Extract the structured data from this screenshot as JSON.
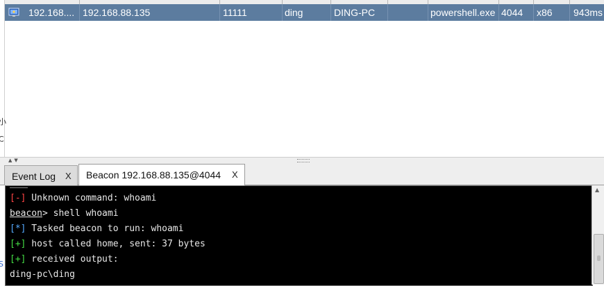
{
  "sessions": {
    "rows": [
      {
        "external": "192.168....",
        "internal": "192.168.88.135",
        "listener": "11111",
        "user": "ding",
        "computer": "DING-PC",
        "process": "powershell.exe",
        "pid": "4044",
        "arch": "x86",
        "last": "943ms"
      }
    ]
  },
  "edge_fragments": [
    "小",
    "C",
    "S"
  ],
  "tabs": [
    {
      "label": "Event Log",
      "close": "X"
    },
    {
      "label": "Beacon 192.168.88.135@4044",
      "close": "X"
    }
  ],
  "console": {
    "lines": [
      {
        "tag": "[-]",
        "text": " Unknown command: whoami"
      },
      {
        "prompt": "beacon",
        "text": "> shell whoami"
      },
      {
        "tag": "[*]",
        "text": " Tasked beacon to run: whoami"
      },
      {
        "tag": "[+]",
        "text": " host called home, sent: 37 bytes"
      },
      {
        "tag": "[+]",
        "text": " received output:"
      },
      {
        "text": "ding-pc\\ding"
      }
    ]
  },
  "colors": {
    "selected_row": "#5c7c9f",
    "console_bg": "#000000",
    "tag_error": "#ff4444",
    "tag_info": "#55aaff",
    "tag_success": "#44dd44"
  }
}
